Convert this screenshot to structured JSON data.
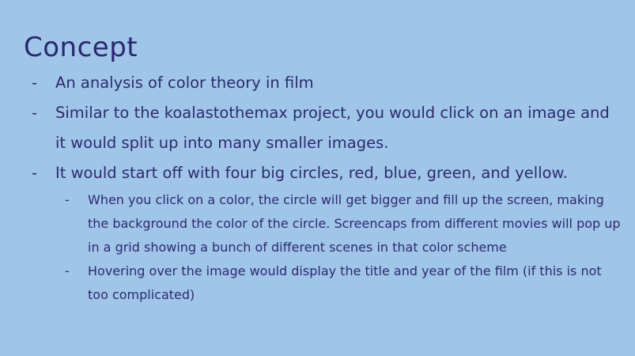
{
  "slide": {
    "title": "Concept",
    "bullets": [
      "An analysis of color theory in film",
      "Similar to the koalastothemax project, you would click on an image and it would split up into many smaller images.",
      "It would start off with four big circles, red, blue, green, and yellow."
    ],
    "sub_bullets": [
      "When you click on a color, the circle will get bigger and fill up the screen, making the background the color of the circle. Screencaps from different movies will pop up in a grid showing a bunch of different scenes in that color scheme",
      "Hovering over the image would display the title and year of the film (if this is not too complicated)"
    ],
    "bullet_marker": "-"
  },
  "colors": {
    "background": "#9fc5e8",
    "text": "#2e2a6e"
  }
}
